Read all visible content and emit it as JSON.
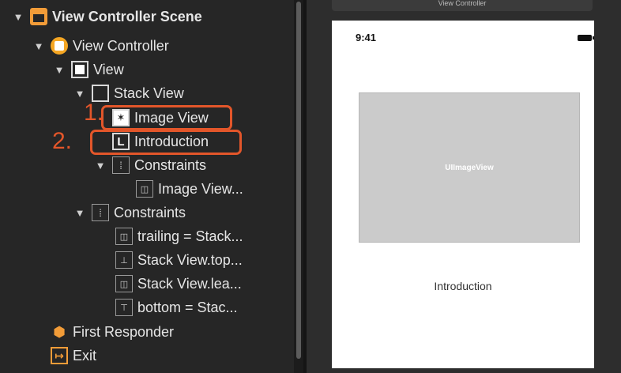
{
  "outline": {
    "items": [
      {
        "label": "View Controller Scene",
        "icon": "scene-icon"
      },
      {
        "label": "View Controller",
        "icon": "view-controller-icon"
      },
      {
        "label": "View",
        "icon": "view-icon"
      },
      {
        "label": "Stack View",
        "icon": "stack-view-icon"
      },
      {
        "label": "Image View",
        "icon": "image-view-icon"
      },
      {
        "label": "Introduction",
        "icon": "label-icon"
      },
      {
        "label": "Constraints",
        "icon": "constraints-icon"
      },
      {
        "label": "Image View...",
        "icon": "constraint-icon"
      },
      {
        "label": "Constraints",
        "icon": "constraints-icon"
      },
      {
        "label": "trailing = Stack...",
        "icon": "constraint-icon"
      },
      {
        "label": "Stack View.top...",
        "icon": "constraint-icon"
      },
      {
        "label": "Stack View.lea...",
        "icon": "constraint-icon"
      },
      {
        "label": "bottom = Stac...",
        "icon": "constraint-icon"
      },
      {
        "label": "First Responder",
        "icon": "first-responder-icon"
      },
      {
        "label": "Exit",
        "icon": "exit-icon"
      }
    ],
    "annotations": [
      "1.",
      "2."
    ],
    "label_icon_glyph": "L"
  },
  "canvas": {
    "scene_title": "View Controller",
    "status_time": "9:41",
    "image_view_text": "UIImageView",
    "label_text": "Introduction"
  },
  "colors": {
    "annotation": "#e3562a",
    "scene_accent": "#f29c38"
  }
}
